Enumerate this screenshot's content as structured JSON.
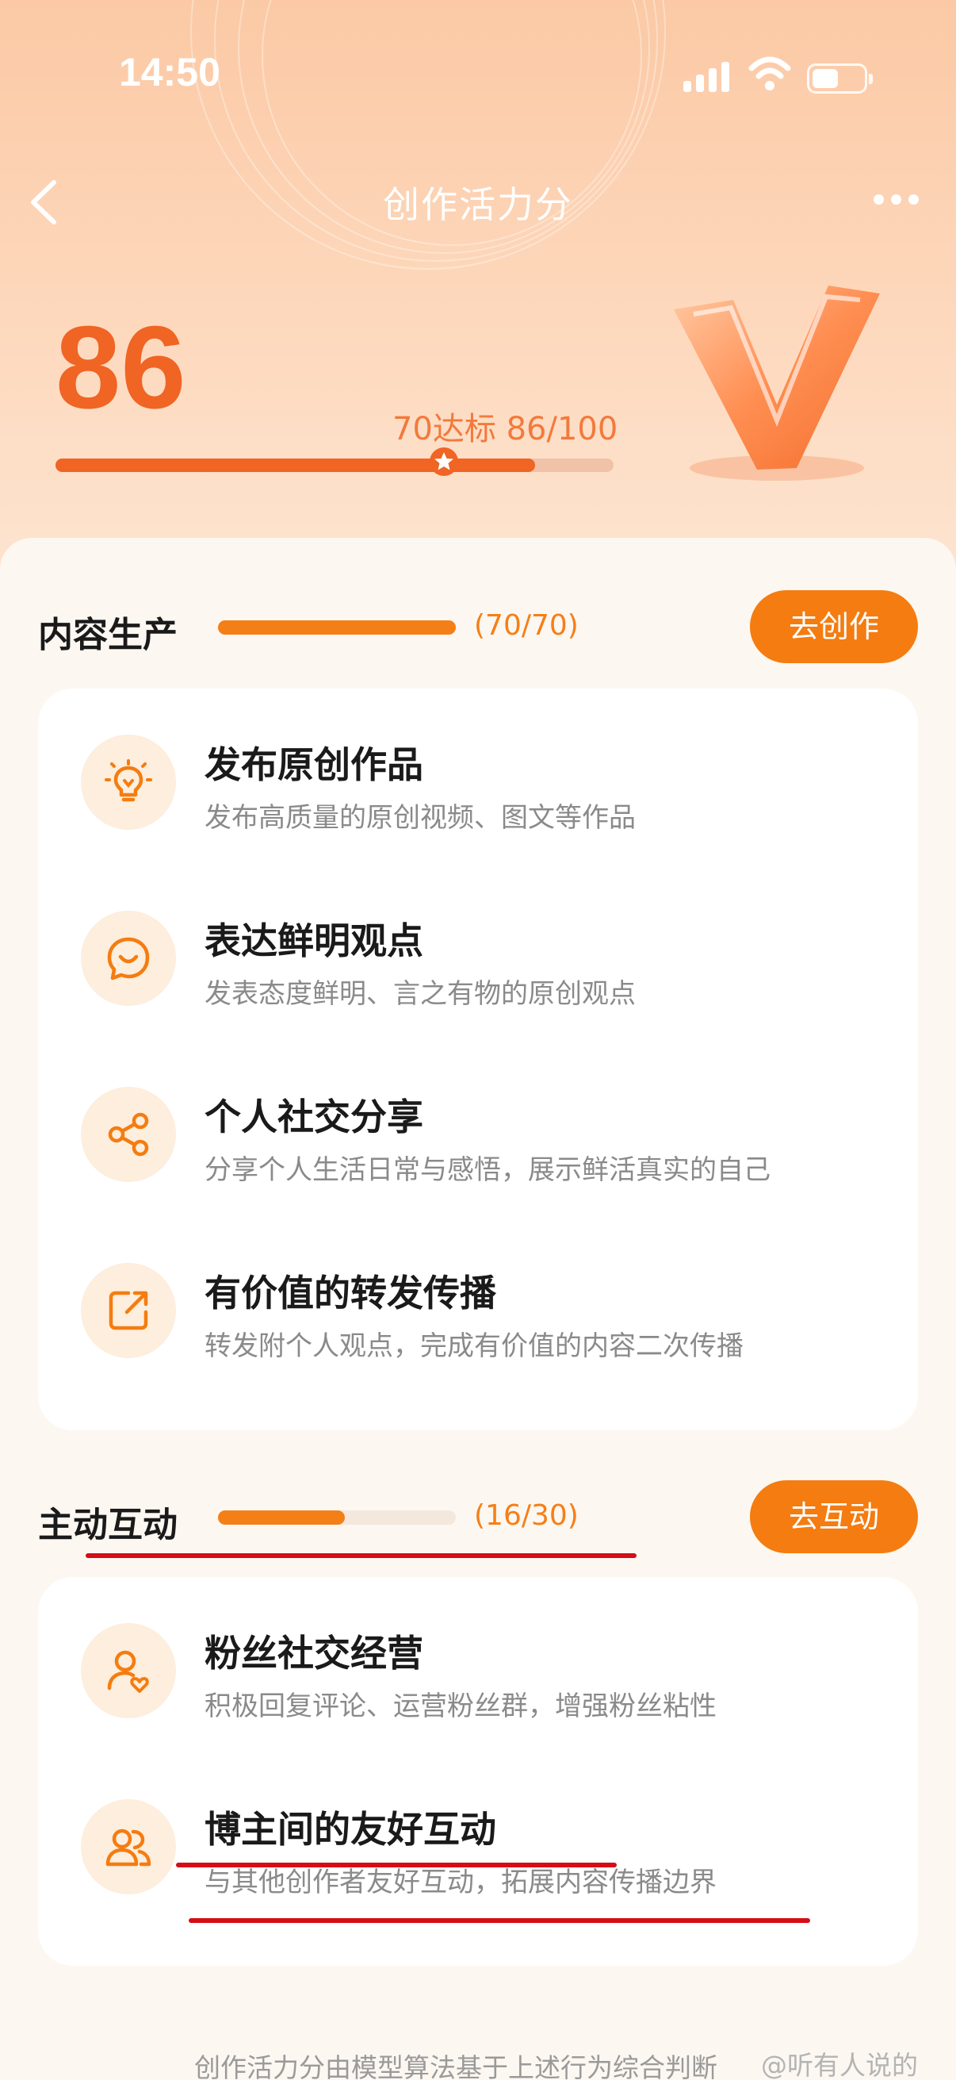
{
  "status_bar": {
    "time": "14:50"
  },
  "nav": {
    "title": "创作活力分"
  },
  "score": {
    "value": "86",
    "target_text": "70达标 86/100",
    "progress": 0.86,
    "pass_mark": 0.7
  },
  "sections": [
    {
      "title": "内容生产",
      "count": "(70/70)",
      "progress": 1.0,
      "button": "去创作",
      "items": [
        {
          "icon": "lightbulb-icon",
          "title": "发布原创作品",
          "desc": "发布高质量的原创视频、图文等作品"
        },
        {
          "icon": "chat-smile-icon",
          "title": "表达鲜明观点",
          "desc": "发表态度鲜明、言之有物的原创观点"
        },
        {
          "icon": "share-icon",
          "title": "个人社交分享",
          "desc": "分享个人生活日常与感悟，展示鲜活真实的自己"
        },
        {
          "icon": "forward-icon",
          "title": "有价值的转发传播",
          "desc": "转发附个人观点，完成有价值的内容二次传播"
        }
      ]
    },
    {
      "title": "主动互动",
      "count": "(16/30)",
      "progress": 0.533,
      "button": "去互动",
      "items": [
        {
          "icon": "user-heart-icon",
          "title": "粉丝社交经营",
          "desc": "积极回复评论、运营粉丝群，增强粉丝粘性"
        },
        {
          "icon": "users-icon",
          "title": "博主间的友好互动",
          "desc": "与其他创作者友好互动，拓展内容传播边界"
        }
      ]
    }
  ],
  "footer": {
    "note": "创作活力分由模型算法基于上述行为综合判断",
    "watermark": "@听有人说的"
  },
  "colors": {
    "accent": "#f57c10",
    "score": "#f06424",
    "annotation": "#d50d17"
  }
}
